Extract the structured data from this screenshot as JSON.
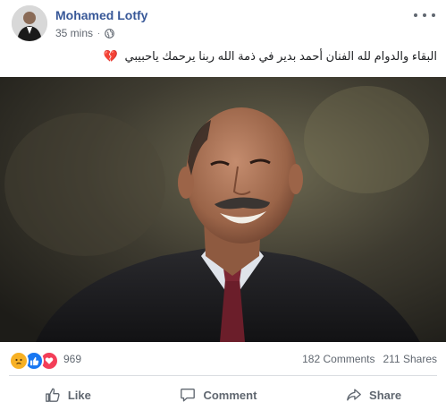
{
  "post": {
    "author": "Mohamed Lotfy",
    "time": "35 mins",
    "separator": "·",
    "privacy_icon": "globe-icon",
    "text": "البقاء والدوام لله الفنان أحمد بدير في ذمة الله ربنا يرحمك ياحبيبي",
    "text_emoji": "💔",
    "more_icon": "more-dots-icon"
  },
  "reactions": {
    "icons": [
      "sad-reaction-icon",
      "like-reaction-icon",
      "love-reaction-icon"
    ],
    "count": "969",
    "comments": "182 Comments",
    "shares": "211 Shares"
  },
  "actions": {
    "like": "Like",
    "comment": "Comment",
    "share": "Share"
  },
  "colors": {
    "name_link": "#385898",
    "muted": "#606770",
    "like_blue": "#1877f2",
    "love_red": "#f33e58",
    "sad_yellow": "#f7b125"
  }
}
